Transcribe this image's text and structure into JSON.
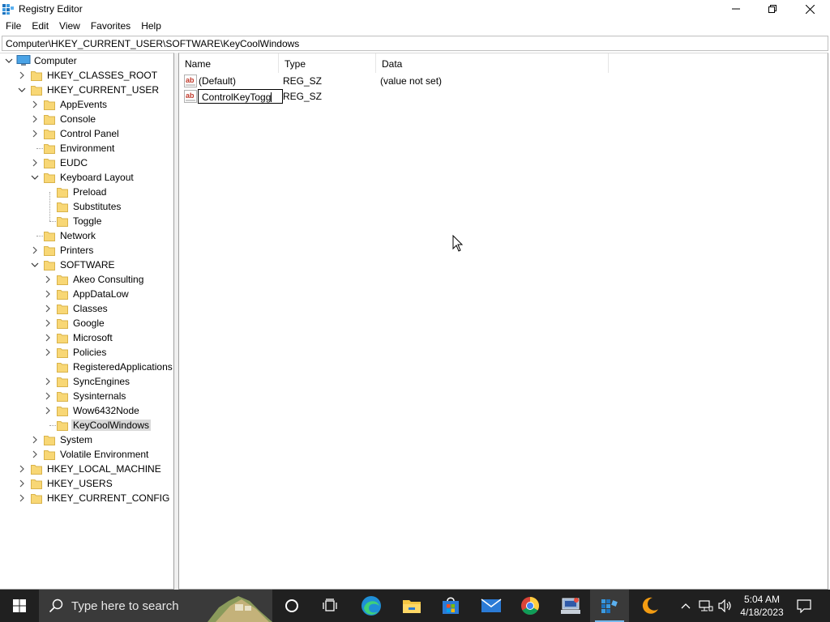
{
  "window": {
    "title": "Registry Editor",
    "menu": [
      "File",
      "Edit",
      "View",
      "Favorites",
      "Help"
    ],
    "address": "Computer\\HKEY_CURRENT_USER\\SOFTWARE\\KeyCoolWindows"
  },
  "tree": {
    "root": "Computer",
    "hkcr": "HKEY_CLASSES_ROOT",
    "hkcu": "HKEY_CURRENT_USER",
    "appevents": "AppEvents",
    "console": "Console",
    "control_panel": "Control Panel",
    "environment": "Environment",
    "eudc": "EUDC",
    "keyboard_layout": "Keyboard Layout",
    "preload": "Preload",
    "substitutes": "Substitutes",
    "toggle": "Toggle",
    "network": "Network",
    "printers": "Printers",
    "software": "SOFTWARE",
    "akeo": "Akeo Consulting",
    "appdatalow": "AppDataLow",
    "classes": "Classes",
    "google": "Google",
    "microsoft": "Microsoft",
    "policies": "Policies",
    "registered_apps": "RegisteredApplications",
    "syncengines": "SyncEngines",
    "sysinternals": "Sysinternals",
    "wow6432": "Wow6432Node",
    "keycoolwindows": "KeyCoolWindows",
    "system": "System",
    "volatile_env": "Volatile Environment",
    "hklm": "HKEY_LOCAL_MACHINE",
    "hku": "HKEY_USERS",
    "hkcc": "HKEY_CURRENT_CONFIG",
    "selected": "KeyCoolWindows"
  },
  "values": {
    "columns": {
      "name": "Name",
      "type": "Type",
      "data": "Data"
    },
    "rows": [
      {
        "name": "(Default)",
        "type": "REG_SZ",
        "data": "(value not set)"
      },
      {
        "name": "ControlKeyTogg",
        "type": "REG_SZ",
        "data": ""
      }
    ],
    "editing_row": 1
  },
  "taskbar": {
    "search_placeholder": "Type here to search",
    "time": "5:04 AM",
    "date": "4/18/2023",
    "icons": [
      "start-icon",
      "cortana-icon",
      "task-view-icon",
      "edge-icon",
      "file-explorer-icon",
      "store-icon",
      "mail-icon",
      "chrome-icon",
      "network-tool-icon",
      "regedit-icon",
      "moon-app-icon"
    ],
    "accent": "#76b9ed"
  },
  "colors": {
    "folder": "#f8d775",
    "selection": "#d9d9d9",
    "taskbar": "#202020"
  }
}
